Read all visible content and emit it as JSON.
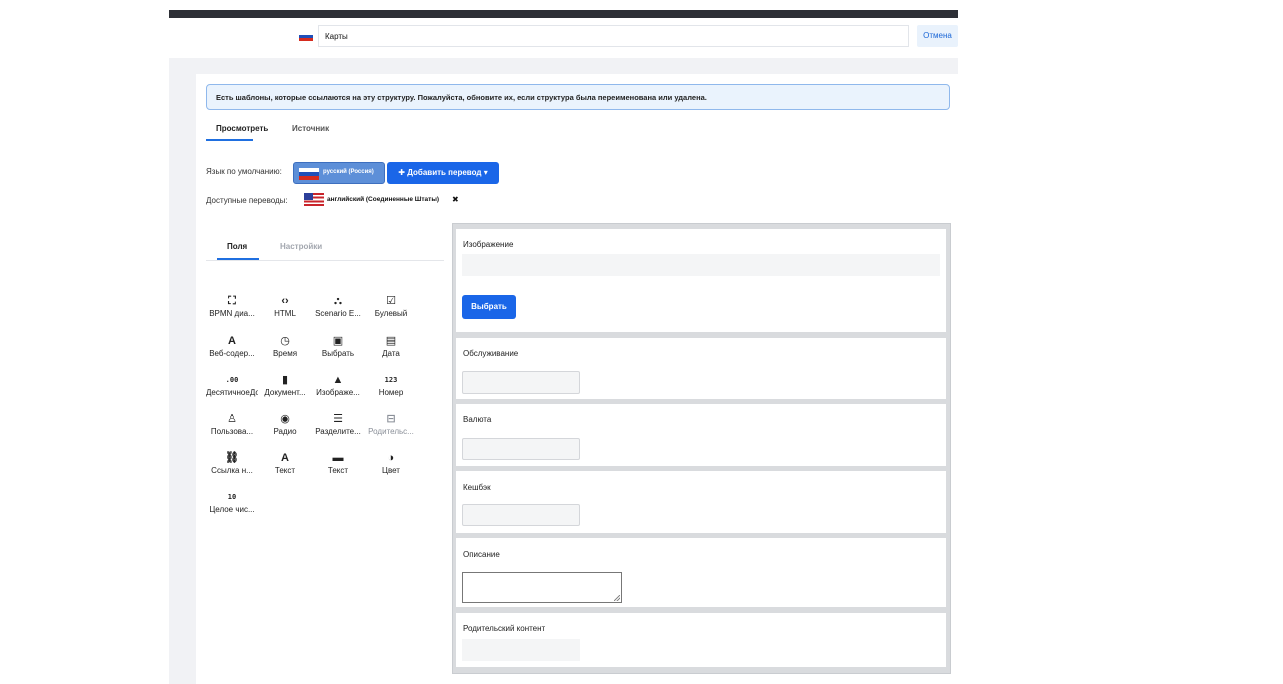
{
  "header": {
    "structure_name": "Карты",
    "cancel_label": "Отмена"
  },
  "alert": {
    "text": "Есть шаблоны, которые ссылаются на эту структуру. Пожалуйста, обновите их, если структура была переименована или удалена."
  },
  "tabs": {
    "view": "Просмотреть",
    "source": "Источник"
  },
  "language": {
    "default_label": "Язык по умолчанию:",
    "default_value": "русский (Россия)",
    "add_translation": "✚ Добавить перевод ▾",
    "available_label": "Доступные переводы:",
    "available": [
      "английский (Соединенные Штаты)"
    ],
    "remove_glyph": "✖"
  },
  "sidebar": {
    "tab_fields": "Поля",
    "tab_settings": "Настройки",
    "palette": [
      {
        "icon": "bpmn-icon",
        "glyph": "⛶",
        "label": "BPMN диа..."
      },
      {
        "icon": "html-icon",
        "glyph": "‹›",
        "label": "HTML"
      },
      {
        "icon": "scenario-icon",
        "glyph": "⛬",
        "label": "Scenario E..."
      },
      {
        "icon": "checkbox-icon",
        "glyph": "☑",
        "label": "Булевый"
      },
      {
        "icon": "rich-text-icon",
        "glyph": "A",
        "label": "Веб-содер..."
      },
      {
        "icon": "clock-icon",
        "glyph": "◷",
        "label": "Время"
      },
      {
        "icon": "select-icon",
        "glyph": "▣",
        "label": "Выбрать"
      },
      {
        "icon": "calendar-icon",
        "glyph": "▤",
        "label": "Дата"
      },
      {
        "icon": "decimal-icon",
        "glyph": ".00",
        "label": "ДесятичноеДокумент...",
        "mono": true
      },
      {
        "icon": "document-icon",
        "glyph": "▮",
        "label": "Документ..."
      },
      {
        "icon": "image-icon",
        "glyph": "▲",
        "label": "Изображе..."
      },
      {
        "icon": "number-icon",
        "glyph": "123",
        "label": "Номер",
        "mono": true
      },
      {
        "icon": "user-icon",
        "glyph": "♙",
        "label": "Пользова..."
      },
      {
        "icon": "radio-icon",
        "glyph": "◉",
        "label": "Радио"
      },
      {
        "icon": "separator-icon",
        "glyph": "☰",
        "label": "Разделите..."
      },
      {
        "icon": "parent-icon",
        "glyph": "⊟",
        "label": "Родительс...",
        "muted": true
      },
      {
        "icon": "link-icon",
        "glyph": "⛓",
        "label": "Ссылка н..."
      },
      {
        "icon": "text-icon",
        "glyph": "A",
        "label": "Текст"
      },
      {
        "icon": "text-box-icon",
        "glyph": "▬",
        "label": "Текст"
      },
      {
        "icon": "color-icon",
        "glyph": "◑",
        "label": "Цвет"
      },
      {
        "icon": "integer-icon",
        "glyph": "10",
        "label": "Целое чис...",
        "mono": true
      }
    ]
  },
  "form": {
    "image_label": "Изображение",
    "select_button": "Выбрать",
    "service_label": "Обслуживание",
    "currency_label": "Валюта",
    "cashback_label": "Кешбэк",
    "description_label": "Описание",
    "parent_content_label": "Родительский контент"
  }
}
